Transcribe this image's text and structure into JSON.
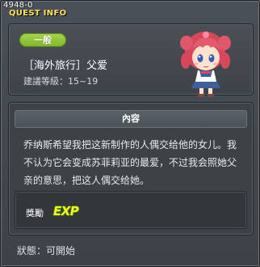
{
  "window": {
    "quest_id": "4948-0",
    "title": "QUEST INFO"
  },
  "quest": {
    "category": "一般",
    "name": "［海外旅行］父爱",
    "level": "建議等級：15~19"
  },
  "content": {
    "header": "內容",
    "description": "乔纳斯希望我把这新制作的人偶交给他的女儿。我不认为它会变成苏菲莉亚的最爱，不过我会照她父亲的意思，把这人偶交给她。"
  },
  "reward": {
    "label": "獎勵",
    "exp_text": "EXP"
  },
  "status": {
    "text": "狀態：可開始"
  },
  "colors": {
    "title": "#ffe35a",
    "badge": "#8fc436",
    "exp": "#ffee2a"
  },
  "icons": {
    "npc": "npc-portrait-icon",
    "exp": "exp-icon"
  }
}
